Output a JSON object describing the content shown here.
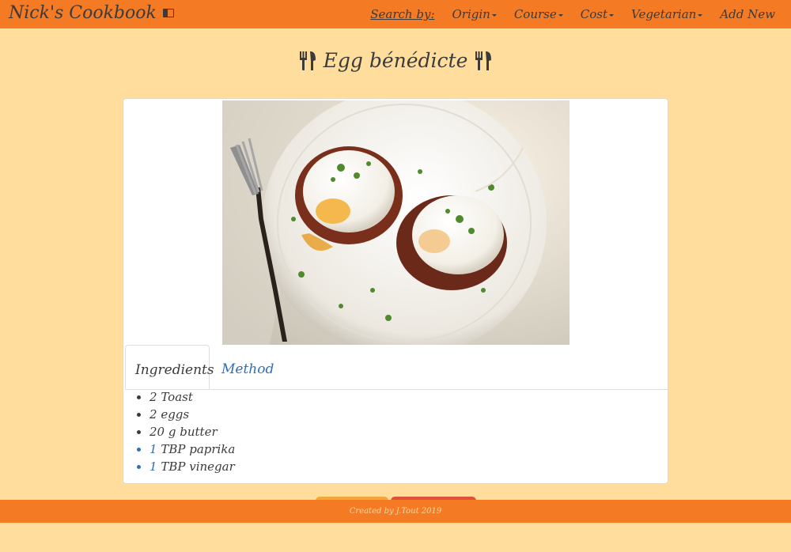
{
  "navbar": {
    "brand": "Nick's Cookbook",
    "search_label": "Search by:",
    "menus": [
      {
        "label": "Origin"
      },
      {
        "label": "Course"
      },
      {
        "label": "Cost"
      },
      {
        "label": "Vegetarian"
      }
    ],
    "add_new": "Add New"
  },
  "page": {
    "title": "Egg bénédicte"
  },
  "tabs": [
    {
      "label": "Ingredients",
      "active": true
    },
    {
      "label": "Method",
      "active": false
    }
  ],
  "ingredients": [
    {
      "qty": "2",
      "item": "Toast"
    },
    {
      "qty": "2",
      "item": "eggs"
    },
    {
      "qty": "20",
      "item": "g butter"
    },
    {
      "qty": "1",
      "item": "TBP paprika"
    },
    {
      "qty": "1",
      "item": "TBP vinegar"
    }
  ],
  "footer": {
    "text": "Created by J.Tout 2019"
  },
  "colors": {
    "navbar": "#f57a24",
    "background": "#ffdd9c",
    "link": "#2f6fb8"
  }
}
